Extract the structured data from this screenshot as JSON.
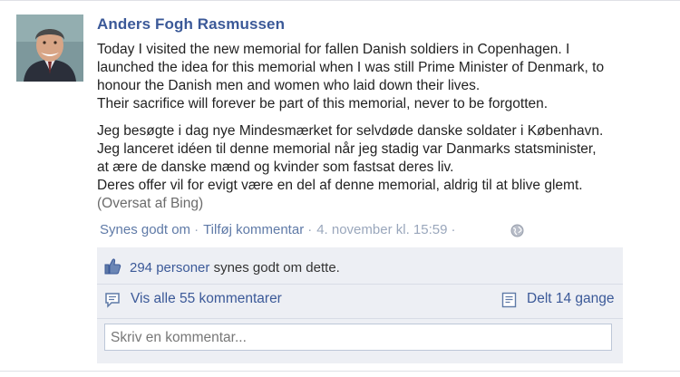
{
  "post": {
    "author": "Anders Fogh Rasmussen",
    "paragraph_en": [
      "Today I visited the new memorial for fallen Danish soldiers in Copenhagen. I",
      "launched the idea for this memorial when I was still Prime Minister of Denmark, to",
      "honour the Danish men and women who laid down their lives.",
      "Their sacrifice will forever be part of this memorial, never to be forgotten."
    ],
    "paragraph_da": [
      "Jeg besøgte i dag nye Mindesmærket for selvdøde danske soldater i København.",
      "Jeg lanceret idéen til denne memorial når jeg stadig var Danmarks statsminister,",
      "at ære de danske mænd og kvinder som fastsat deres liv.",
      "Deres offer vil for evigt være en del af denne memorial, aldrig til at blive glemt."
    ],
    "translation_note": "(Oversat af Bing)"
  },
  "actions": {
    "like": "Synes godt om",
    "dot1": "·",
    "comment": "Tilføj kommentar",
    "dot2": "·",
    "timestamp": "4. november kl. 15:59",
    "dot3": "·"
  },
  "likes": {
    "count_text": "294 personer",
    "suffix": "synes godt om dette."
  },
  "comments": {
    "view_all": "Vis alle 55 kommentarer",
    "shared": "Delt 14 gange"
  },
  "comment_box": {
    "placeholder": "Skriv en kommentar..."
  },
  "colors": {
    "link": "#3b5998",
    "panel_bg": "#edeff4"
  }
}
